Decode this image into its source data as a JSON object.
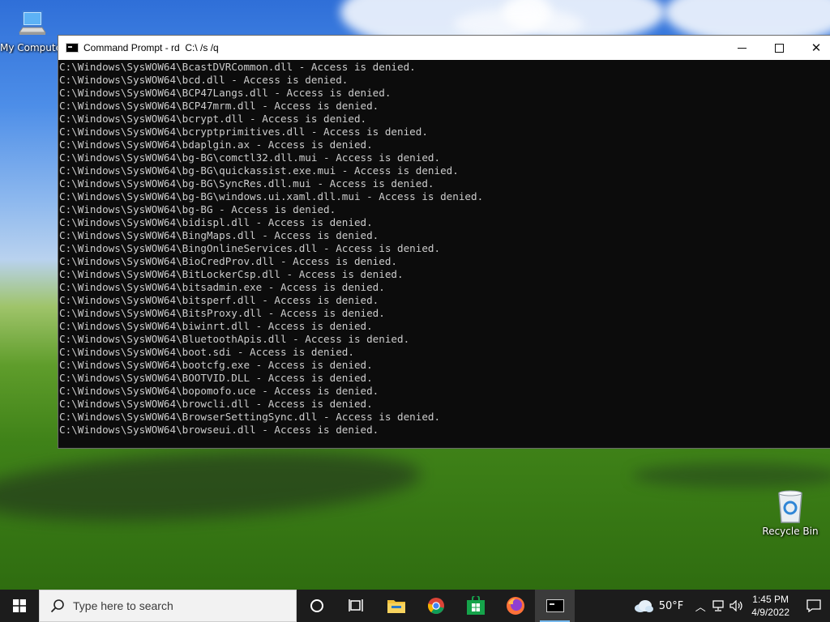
{
  "desktop": {
    "icons": [
      {
        "label": "My Computer",
        "icon": "computer-icon"
      },
      {
        "label": "Recycle Bin",
        "icon": "recycle-bin-icon"
      }
    ]
  },
  "window": {
    "title": "Command Prompt - rd  C:\\ /s /q",
    "icon": "cmd-icon",
    "controls": {
      "minimize": "—",
      "maximize": "☐",
      "close": "✕"
    },
    "lines": [
      "C:\\Windows\\SysWOW64\\BcastDVRCommon.dll - Access is denied.",
      "C:\\Windows\\SysWOW64\\bcd.dll - Access is denied.",
      "C:\\Windows\\SysWOW64\\BCP47Langs.dll - Access is denied.",
      "C:\\Windows\\SysWOW64\\BCP47mrm.dll - Access is denied.",
      "C:\\Windows\\SysWOW64\\bcrypt.dll - Access is denied.",
      "C:\\Windows\\SysWOW64\\bcryptprimitives.dll - Access is denied.",
      "C:\\Windows\\SysWOW64\\bdaplgin.ax - Access is denied.",
      "C:\\Windows\\SysWOW64\\bg-BG\\comctl32.dll.mui - Access is denied.",
      "C:\\Windows\\SysWOW64\\bg-BG\\quickassist.exe.mui - Access is denied.",
      "C:\\Windows\\SysWOW64\\bg-BG\\SyncRes.dll.mui - Access is denied.",
      "C:\\Windows\\SysWOW64\\bg-BG\\windows.ui.xaml.dll.mui - Access is denied.",
      "C:\\Windows\\SysWOW64\\bg-BG - Access is denied.",
      "C:\\Windows\\SysWOW64\\bidispl.dll - Access is denied.",
      "C:\\Windows\\SysWOW64\\BingMaps.dll - Access is denied.",
      "C:\\Windows\\SysWOW64\\BingOnlineServices.dll - Access is denied.",
      "C:\\Windows\\SysWOW64\\BioCredProv.dll - Access is denied.",
      "C:\\Windows\\SysWOW64\\BitLockerCsp.dll - Access is denied.",
      "C:\\Windows\\SysWOW64\\bitsadmin.exe - Access is denied.",
      "C:\\Windows\\SysWOW64\\bitsperf.dll - Access is denied.",
      "C:\\Windows\\SysWOW64\\BitsProxy.dll - Access is denied.",
      "C:\\Windows\\SysWOW64\\biwinrt.dll - Access is denied.",
      "C:\\Windows\\SysWOW64\\BluetoothApis.dll - Access is denied.",
      "C:\\Windows\\SysWOW64\\boot.sdi - Access is denied.",
      "C:\\Windows\\SysWOW64\\bootcfg.exe - Access is denied.",
      "C:\\Windows\\SysWOW64\\BOOTVID.DLL - Access is denied.",
      "C:\\Windows\\SysWOW64\\bopomofo.uce - Access is denied.",
      "C:\\Windows\\SysWOW64\\browcli.dll - Access is denied.",
      "C:\\Windows\\SysWOW64\\BrowserSettingSync.dll - Access is denied.",
      "C:\\Windows\\SysWOW64\\browseui.dll - Access is denied."
    ]
  },
  "taskbar": {
    "search_placeholder": "Type here to search",
    "apps": [
      {
        "name": "task-view",
        "icon": "cortana-circle-icon"
      },
      {
        "name": "timeline",
        "icon": "task-view-icon"
      },
      {
        "name": "file-explorer",
        "icon": "folder-icon"
      },
      {
        "name": "chrome",
        "icon": "chrome-icon"
      },
      {
        "name": "store",
        "icon": "store-icon"
      },
      {
        "name": "firefox",
        "icon": "firefox-icon"
      },
      {
        "name": "command-prompt",
        "icon": "cmd-icon",
        "active": true
      }
    ],
    "weather": {
      "temp": "50°F",
      "icon": "cloud-icon"
    },
    "clock": {
      "time": "1:45 PM",
      "date": "4/9/2022"
    }
  }
}
